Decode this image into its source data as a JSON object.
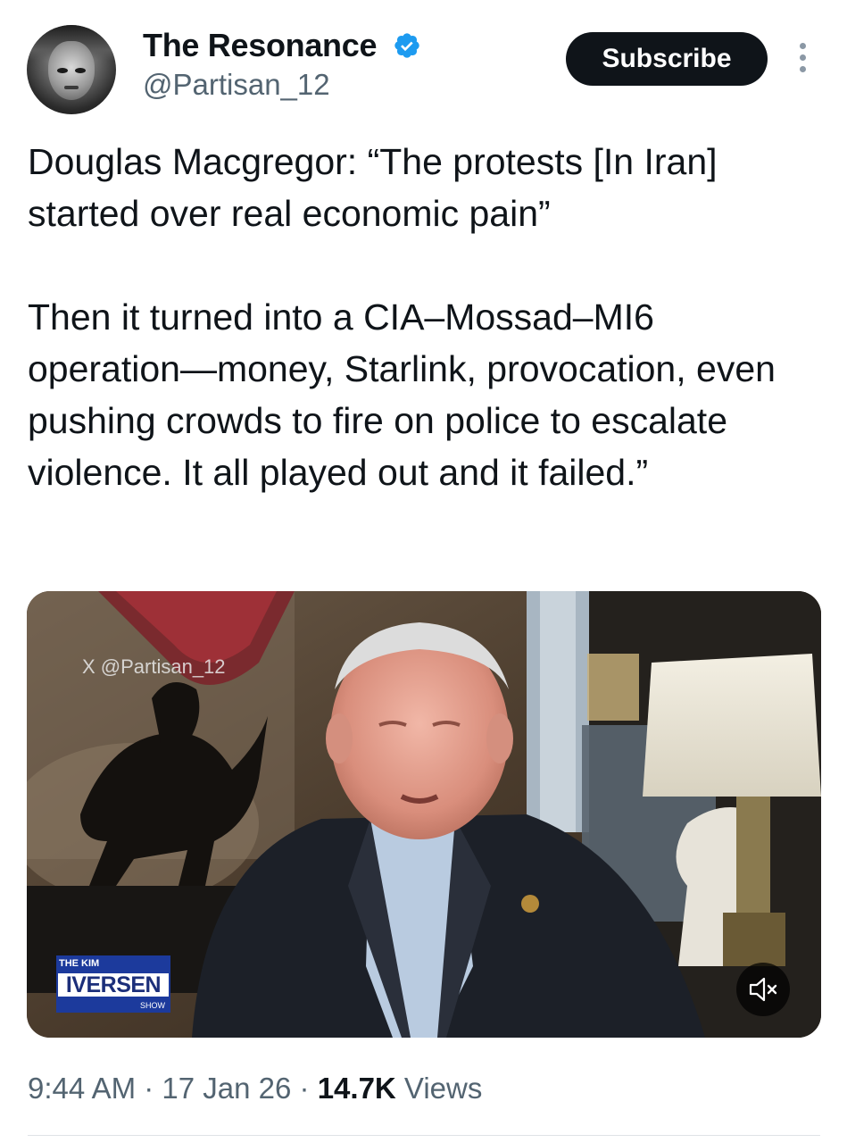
{
  "author": {
    "display_name": "The Resonance",
    "handle": "@Partisan_12",
    "verified": true,
    "avatar_icon": "avatar-photo"
  },
  "header": {
    "subscribe_label": "Subscribe",
    "more_icon": "more-vertical-icon"
  },
  "tweet": {
    "paragraphs": [
      "Douglas Macgregor: “The protests [In Iran] started over real economic pain”",
      "Then it turned into a CIA–Mossad–MI6 operation—money, Starlink, provocation, even pushing crowds to fire on police to escalate violence. It all played out and it failed.”"
    ]
  },
  "media": {
    "watermark": "X @Partisan_12",
    "show_logo": {
      "prefix": "THE KIM",
      "name": "IVERSEN",
      "suffix": "SHOW"
    },
    "mute_icon": "volume-muted-icon"
  },
  "meta": {
    "time": "9:44 AM",
    "separator": " · ",
    "date": "17 Jan 26",
    "views_count": "14.7K",
    "views_label": " Views"
  },
  "colors": {
    "text": "#0f1419",
    "secondary": "#536471",
    "verified_blue": "#1d9bf0",
    "button_bg": "#0f1419"
  }
}
